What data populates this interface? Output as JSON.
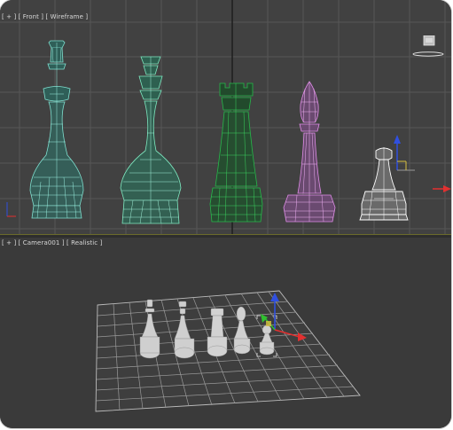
{
  "viewports": {
    "front": {
      "label": "[ + ] [ Front ] [ Wireframe ]",
      "pieces": [
        "king",
        "queen",
        "rook",
        "bishop",
        "pawn"
      ]
    },
    "camera": {
      "label": "[ + ] [ Camera001 ] [ Realistic ]",
      "pieces": [
        "king",
        "queen",
        "rook",
        "bishop",
        "pawn"
      ]
    }
  },
  "colors": {
    "viewport_bg": "#414141",
    "grid": "#5a5a5a",
    "king_wire": "#7fe0d0",
    "queen_wire": "#7ee8c0",
    "rook_wire": "#26b84a",
    "bishop_wire": "#e08ce8",
    "pawn_wire": "#ffffff",
    "separator": "#8a8a2a",
    "axis_x": "#e23030",
    "axis_y": "#30c030",
    "axis_z": "#3050e0"
  },
  "icons": [
    "viewcube-icon",
    "transform-gizmo-icon",
    "world-axis-icon"
  ]
}
